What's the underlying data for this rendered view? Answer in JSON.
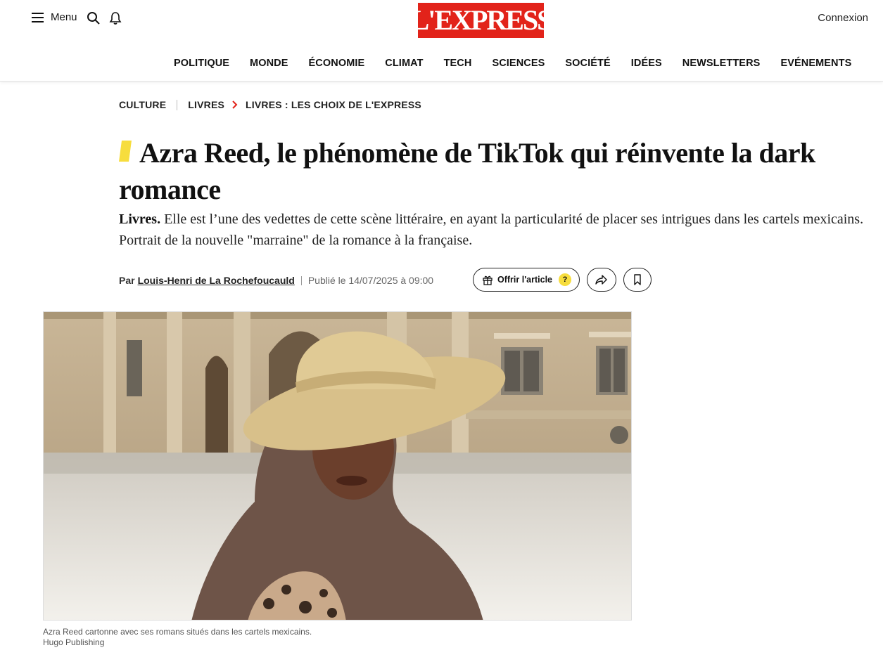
{
  "header": {
    "menu_label": "Menu",
    "logo_text": "L'EXPRESS",
    "login_label": "Connexion",
    "brand_color": "#e2231a"
  },
  "nav": {
    "items": [
      "POLITIQUE",
      "MONDE",
      "ÉCONOMIE",
      "CLIMAT",
      "TECH",
      "SCIENCES",
      "SOCIÉTÉ",
      "IDÉES",
      "NEWSLETTERS",
      "EVÉNEMENTS"
    ]
  },
  "breadcrumb": {
    "items": [
      "CULTURE",
      "LIVRES",
      "LIVRES : LES CHOIX DE L'EXPRESS"
    ]
  },
  "article": {
    "title": "Azra Reed, le phénomène de TikTok qui réinvente la dark romance",
    "lede_kicker": "Livres.",
    "lede_text": " Elle est l’une des vedettes de cette scène littéraire, en ayant la particularité de placer ses intrigues dans les cartels mexicains. Portrait de la nouvelle \"marraine\" de la romance à la française.",
    "by_prefix": "Par",
    "author": "Louis-Henri de La Rochefoucauld",
    "published": "Publié le 14/07/2025 à 09:00",
    "offer_label": "Offrir l'article",
    "offer_help": "?",
    "accent_color": "#f7dd3d"
  },
  "image": {
    "caption": "Azra Reed cartonne avec ses romans situés dans les cartels mexicains.",
    "credit": "Hugo Publishing"
  },
  "icons": {
    "menu": "hamburger-icon",
    "search": "search-icon",
    "notifications": "bell-icon",
    "gift": "gift-icon",
    "share": "share-icon",
    "bookmark": "bookmark-icon"
  }
}
